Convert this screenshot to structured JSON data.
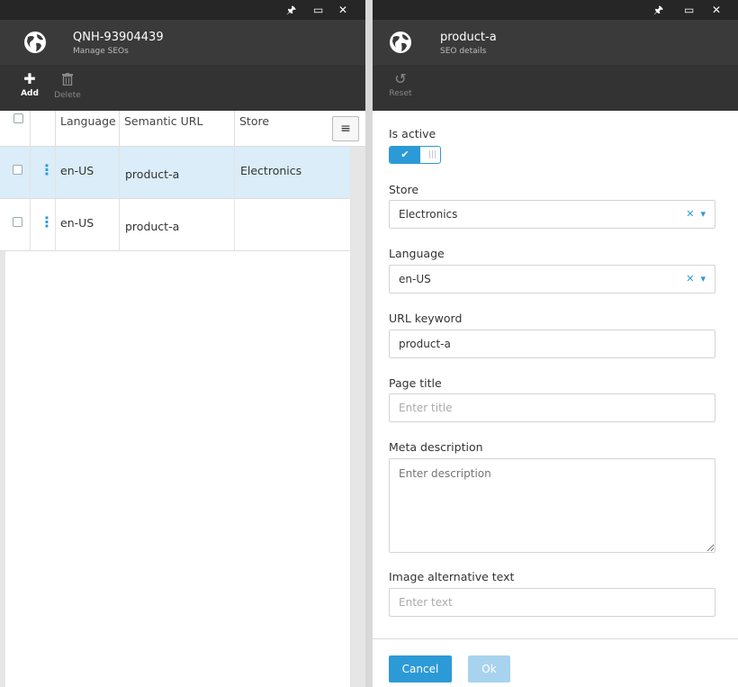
{
  "left_blade": {
    "window_controls": {
      "pin": "🖈",
      "maximize": "▭",
      "close": "✕"
    },
    "title": "QNH-93904439",
    "subtitle": "Manage SEOs",
    "toolbar": {
      "add_label": "Add",
      "delete_label": "Delete"
    },
    "grid": {
      "columns": [
        "Language",
        "Semantic URL",
        "Store"
      ],
      "rows": [
        {
          "language": "en-US",
          "semantic_url": "product-a",
          "store": "Electronics",
          "selected": true
        },
        {
          "language": "en-US",
          "semantic_url": "product-a",
          "store": "",
          "selected": false
        }
      ]
    }
  },
  "right_blade": {
    "window_controls": {
      "pin": "🖈",
      "maximize": "▭",
      "close": "✕"
    },
    "title": "product-a",
    "subtitle": "SEO details",
    "toolbar": {
      "reset_label": "Reset"
    },
    "form": {
      "is_active_label": "Is active",
      "is_active": true,
      "store_label": "Store",
      "store_value": "Electronics",
      "language_label": "Language",
      "language_value": "en-US",
      "url_keyword_label": "URL keyword",
      "url_keyword_value": "product-a",
      "page_title_label": "Page title",
      "page_title_placeholder": "Enter title",
      "meta_description_label": "Meta description",
      "meta_description_placeholder": "Enter description",
      "image_alt_label": "Image alternative text",
      "image_alt_placeholder": "Enter text"
    },
    "footer": {
      "cancel_label": "Cancel",
      "ok_label": "Ok"
    }
  },
  "colors": {
    "accent": "#2c9ad6",
    "header_bg": "#3a3a3a",
    "selected_row": "#daedf8"
  }
}
